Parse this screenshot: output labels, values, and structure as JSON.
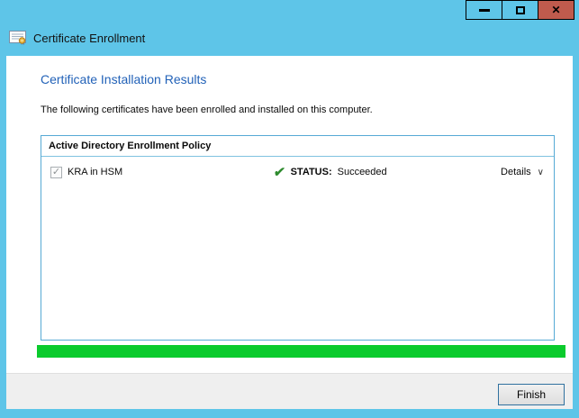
{
  "window": {
    "title": "Certificate Enrollment",
    "controls": {
      "minimize": "minimize",
      "maximize": "maximize",
      "close_glyph": "✕"
    }
  },
  "page": {
    "heading": "Certificate Installation Results",
    "description": "The following certificates have been enrolled and installed on this computer."
  },
  "enrollment_list": {
    "header": "Active Directory Enrollment Policy",
    "rows": [
      {
        "name": "KRA in HSM",
        "checked": true,
        "checkbox_glyph": "✓",
        "check_glyph": "✔",
        "status_label": "STATUS:",
        "status_value": "Succeeded",
        "details_label": "Details",
        "chevron_glyph": "∨"
      }
    ]
  },
  "progress": {
    "percent": 100
  },
  "footer": {
    "finish_label": "Finish"
  },
  "colors": {
    "titlebar-blue": "#5EC5E8",
    "close-red": "#C05B4D",
    "heading-blue": "#2262B8",
    "list-border-blue": "#56AAD5",
    "success-green": "#2E8B2E",
    "progress-green": "#0BCB2D"
  }
}
